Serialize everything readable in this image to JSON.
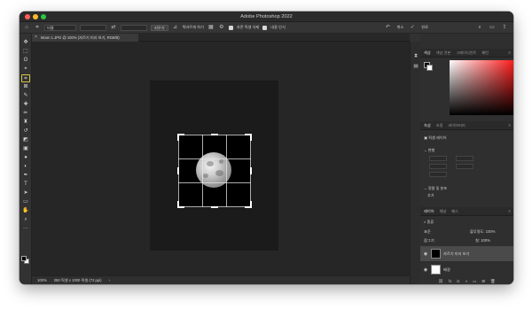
{
  "window": {
    "title": "Adobe Photoshop 2022"
  },
  "options_bar": {
    "ratio_select": "비율",
    "clear_button": "지우기",
    "straighten_label": "똑바르게 하기",
    "delete_cropped_label": "자른 픽셀 삭제",
    "content_aware_label": "내용 인식",
    "cancel_label": "취소",
    "commit_label": "완료"
  },
  "document_tab": {
    "label": "Moon 1.JPG @ 100% (자르기 미리 보기, RGB/8)"
  },
  "status_bar": {
    "zoom": "100%",
    "info": "250 픽셀 x 1000 픽셀 (72 ppi)"
  },
  "color_panel": {
    "tabs": [
      "색상",
      "색상 견본",
      "그레이디언트",
      "패턴"
    ],
    "active_tab": 0,
    "foreground": "#000000",
    "background": "#ffffff"
  },
  "properties_panel": {
    "tabs": [
      "속성",
      "조정",
      "라이브러리"
    ],
    "active_tab": 0,
    "section_layer": "픽셀 레이어",
    "section_transform": "변형",
    "section_align": "정렬 및 분포",
    "align_more": "추가"
  },
  "layers_panel": {
    "tabs": [
      "레이어",
      "채널",
      "패스"
    ],
    "active_tab": 0,
    "search_placeholder": "종류",
    "blend_mode": "표준",
    "opacity_label": "불투명도:",
    "opacity_value": "100%",
    "lock_label": "잠그기:",
    "fill_label": "칠:",
    "fill_value": "100%",
    "layers": [
      {
        "name": "자르기 미리 보기",
        "thumb": "black",
        "selected": true
      },
      {
        "name": "배경",
        "thumb": "white",
        "selected": false
      }
    ]
  },
  "tools": [
    {
      "name": "move-tool",
      "glyph": "✥"
    },
    {
      "name": "marquee-tool",
      "glyph": "⬚"
    },
    {
      "name": "lasso-tool",
      "glyph": "ʘ"
    },
    {
      "name": "object-select-tool",
      "glyph": "⌖"
    },
    {
      "name": "crop-tool",
      "glyph": "⌗"
    },
    {
      "name": "frame-tool",
      "glyph": "⊠"
    },
    {
      "name": "eyedropper-tool",
      "glyph": "✎"
    },
    {
      "name": "spot-heal-tool",
      "glyph": "✚"
    },
    {
      "name": "brush-tool",
      "glyph": "✏"
    },
    {
      "name": "stamp-tool",
      "glyph": "♜"
    },
    {
      "name": "history-brush-tool",
      "glyph": "↺"
    },
    {
      "name": "eraser-tool",
      "glyph": "◩"
    },
    {
      "name": "gradient-tool",
      "glyph": "▣"
    },
    {
      "name": "blur-tool",
      "glyph": "●"
    },
    {
      "name": "dodge-tool",
      "glyph": "◐"
    },
    {
      "name": "pen-tool",
      "glyph": "✒"
    },
    {
      "name": "type-tool",
      "glyph": "T"
    },
    {
      "name": "path-select-tool",
      "glyph": "➤"
    },
    {
      "name": "shape-tool",
      "glyph": "▭"
    },
    {
      "name": "hand-tool",
      "glyph": "✋"
    },
    {
      "name": "zoom-tool",
      "glyph": "⌕"
    },
    {
      "name": "more-tools",
      "glyph": "···"
    }
  ],
  "active_tool": "crop-tool"
}
